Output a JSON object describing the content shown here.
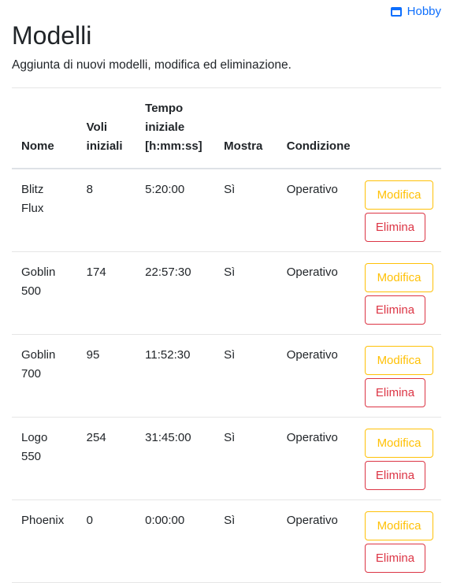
{
  "nav": {
    "link_label": "Hobby",
    "link_icon": "window-icon"
  },
  "header": {
    "title": "Modelli",
    "subtitle": "Aggiunta di nuovi modelli, modifica ed eliminazione."
  },
  "table": {
    "columns": [
      "Nome",
      "Voli iniziali",
      "Tempo iniziale [h:mm:ss]",
      "Mostra",
      "Condizione",
      ""
    ],
    "rows": [
      {
        "nome": "Blitz Flux",
        "voli": "8",
        "tempo": "5:20:00",
        "mostra": "Sì",
        "condizione": "Operativo"
      },
      {
        "nome": "Goblin 500",
        "voli": "174",
        "tempo": "22:57:30",
        "mostra": "Sì",
        "condizione": "Operativo"
      },
      {
        "nome": "Goblin 700",
        "voli": "95",
        "tempo": "11:52:30",
        "mostra": "Sì",
        "condizione": "Operativo"
      },
      {
        "nome": "Logo 550",
        "voli": "254",
        "tempo": "31:45:00",
        "mostra": "Sì",
        "condizione": "Operativo"
      },
      {
        "nome": "Phoenix",
        "voli": "0",
        "tempo": "0:00:00",
        "mostra": "Sì",
        "condizione": "Operativo"
      }
    ],
    "edit_label": "Modifica",
    "delete_label": "Elimina"
  },
  "colors": {
    "link": "#0d6efd",
    "edit": "#ffc107",
    "delete": "#dc3545"
  }
}
